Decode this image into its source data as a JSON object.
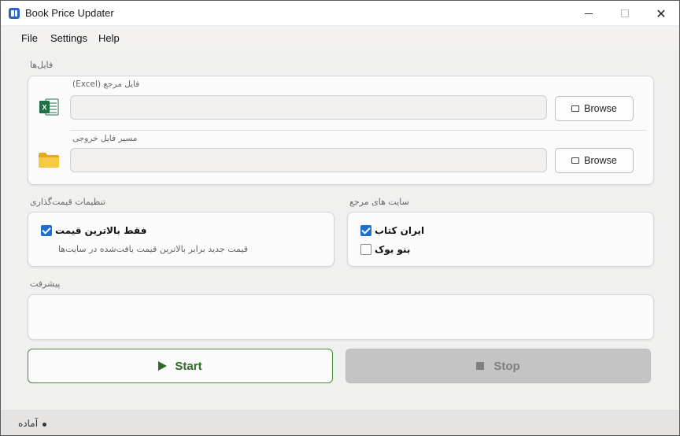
{
  "window": {
    "title": "Book Price Updater",
    "close_glyph": "✕"
  },
  "menu": {
    "items": [
      "File",
      "Settings",
      "Help"
    ]
  },
  "files": {
    "section_label": "فایل‌ها",
    "reference": {
      "label": "فایل مرجع (Excel)",
      "value": "",
      "browse_label": "Browse",
      "icon": "excel-icon"
    },
    "output": {
      "label": "مسیر فایل خروجی",
      "value": "",
      "browse_label": "Browse",
      "icon": "folder-icon"
    }
  },
  "pricing": {
    "section_label": "تنظیمات قیمت‌گذاری",
    "option_label": "فقط بالاترین قیمت",
    "option_checked": true,
    "hint": "قیمت جدید برابر بالاترین قیمت یافت‌شده در سایت‌ها"
  },
  "sites": {
    "section_label": "سایت های مرجع",
    "items": [
      {
        "label": "ایران کتاب",
        "checked": true
      },
      {
        "label": "بنو بوک",
        "checked": false
      }
    ]
  },
  "progress": {
    "section_label": "پیشرفت",
    "value": ""
  },
  "actions": {
    "start_label": "Start",
    "stop_label": "Stop"
  },
  "status": {
    "text": "آماده"
  },
  "colors": {
    "accent": "#1f6fd1",
    "start": "#2e6a25",
    "excel": "#1e7145",
    "folder": "#f5c02c"
  }
}
